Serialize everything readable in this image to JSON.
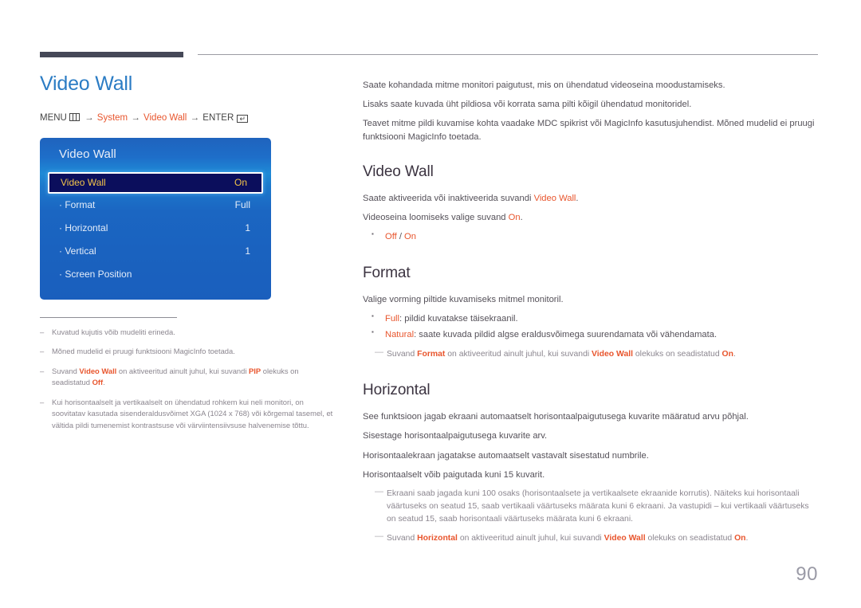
{
  "page": {
    "number": "90"
  },
  "left": {
    "title": "Video Wall",
    "menu_path": {
      "menu_label": "MENU",
      "menu_icon": "menu-grid-icon",
      "arrow": "→",
      "item1": "System",
      "item2": "Video Wall",
      "enter_label": "ENTER",
      "enter_icon": "enter-key-icon",
      "enter_glyph": "↵"
    },
    "osd": {
      "title": "Video Wall",
      "rows": [
        {
          "label": "Video Wall",
          "value": "On",
          "selected": true
        },
        {
          "label": "· Format",
          "value": "Full",
          "selected": false
        },
        {
          "label": "· Horizontal",
          "value": "1",
          "selected": false
        },
        {
          "label": "· Vertical",
          "value": "1",
          "selected": false
        },
        {
          "label": "· Screen Position",
          "value": "",
          "selected": false
        }
      ]
    },
    "notes": [
      {
        "dash": "–",
        "parts": [
          {
            "t": "Kuvatud kujutis võib mudeliti erineda.",
            "hot": false
          }
        ]
      },
      {
        "dash": "–",
        "parts": [
          {
            "t": "Mõned mudelid ei pruugi funktsiooni MagicInfo toetada.",
            "hot": false
          }
        ]
      },
      {
        "dash": "–",
        "parts": [
          {
            "t": "Suvand ",
            "hot": false
          },
          {
            "t": "Video Wall",
            "hot": true
          },
          {
            "t": " on aktiveeritud ainult juhul, kui suvandi ",
            "hot": false
          },
          {
            "t": "PIP",
            "hot": true
          },
          {
            "t": " olekuks on seadistatud ",
            "hot": false
          },
          {
            "t": "Off",
            "hot": true
          },
          {
            "t": ".",
            "hot": false
          }
        ]
      },
      {
        "dash": "–",
        "parts": [
          {
            "t": "Kui horisontaalselt ja vertikaalselt on ühendatud rohkem kui neli monitori, on soovitatav kasutada sisenderaldusvõimet XGA (1024 x 768) või kõrgemal tasemel, et vältida pildi tumenemist kontrastsuse või värviintensiivsuse halvenemise tõttu.",
            "hot": false
          }
        ]
      }
    ]
  },
  "right": {
    "intro": [
      "Saate kohandada mitme monitori paigutust, mis on ühendatud videoseina moodustamiseks.",
      "Lisaks saate kuvada üht pildiosa või korrata sama pilti kõigil ühendatud monitoridel.",
      "Teavet mitme pildi kuvamise kohta vaadake MDC spikrist või MagicInfo kasutusjuhendist. Mõned mudelid ei pruugi funktsiooni MagicInfo toetada."
    ],
    "sections": [
      {
        "heading": "Video Wall",
        "paras": [
          [
            {
              "t": "Saate aktiveerida või inaktiveerida suvandi ",
              "hot": false
            },
            {
              "t": "Video Wall",
              "hot": true
            },
            {
              "t": ".",
              "hot": false
            }
          ],
          [
            {
              "t": "Videoseina loomiseks valige suvand ",
              "hot": false
            },
            {
              "t": "On",
              "hot": true
            },
            {
              "t": ".",
              "hot": false
            }
          ]
        ],
        "bullets": [
          [
            {
              "t": "Off",
              "hot": true
            },
            {
              "t": " / ",
              "hot": false
            },
            {
              "t": "On",
              "hot": true
            }
          ]
        ],
        "notes": []
      },
      {
        "heading": "Format",
        "paras": [
          [
            {
              "t": "Valige vorming piltide kuvamiseks mitmel monitoril.",
              "hot": false
            }
          ]
        ],
        "bullets": [
          [
            {
              "t": "Full",
              "hot": true
            },
            {
              "t": ": pildid kuvatakse täisekraanil.",
              "hot": false
            }
          ],
          [
            {
              "t": "Natural",
              "hot": true
            },
            {
              "t": ": saate kuvada pildid algse eraldusvõimega suurendamata või vähendamata.",
              "hot": false
            }
          ]
        ],
        "notes": [
          {
            "dash": "—",
            "indent": true,
            "parts": [
              {
                "t": "Suvand ",
                "hot": false
              },
              {
                "t": "Format",
                "hot": true
              },
              {
                "t": " on aktiveeritud ainult juhul, kui suvandi ",
                "hot": false
              },
              {
                "t": "Video Wall",
                "hot": true
              },
              {
                "t": " olekuks on seadistatud ",
                "hot": false
              },
              {
                "t": "On",
                "hot": true
              },
              {
                "t": ".",
                "hot": false
              }
            ]
          }
        ]
      },
      {
        "heading": "Horizontal",
        "paras": [
          [
            {
              "t": "See funktsioon jagab ekraani automaatselt horisontaalpaigutusega kuvarite määratud arvu põhjal.",
              "hot": false
            }
          ],
          [
            {
              "t": "Sisestage horisontaalpaigutusega kuvarite arv.",
              "hot": false
            }
          ],
          [
            {
              "t": "Horisontaalekraan jagatakse automaatselt vastavalt sisestatud numbrile.",
              "hot": false
            }
          ],
          [
            {
              "t": "Horisontaalselt võib paigutada kuni 15 kuvarit.",
              "hot": false
            }
          ]
        ],
        "bullets": [],
        "notes": [
          {
            "dash": "—",
            "indent": true,
            "parts": [
              {
                "t": "Ekraani saab jagada kuni 100 osaks (horisontaalsete ja vertikaalsete ekraanide korrutis). Näiteks kui horisontaali väärtuseks on seatud 15, saab vertikaali väärtuseks määrata kuni 6 ekraani. Ja vastupidi – kui vertikaali väärtuseks on seatud 15, saab horisontaali väärtuseks määrata kuni 6 ekraani.",
                "hot": false
              }
            ]
          },
          {
            "dash": "—",
            "indent": true,
            "parts": [
              {
                "t": "Suvand ",
                "hot": false
              },
              {
                "t": "Horizontal",
                "hot": true
              },
              {
                "t": " on aktiveeritud ainult juhul, kui suvandi ",
                "hot": false
              },
              {
                "t": "Video Wall",
                "hot": true
              },
              {
                "t": " olekuks on seadistatud ",
                "hot": false
              },
              {
                "t": "On",
                "hot": true
              },
              {
                "t": ".",
                "hot": false
              }
            ]
          }
        ]
      }
    ]
  },
  "colors": {
    "accent_blue": "#2b7cc4",
    "accent_orange": "#e8552d",
    "heading_dark": "#3b3340",
    "rule_dark": "#454857",
    "osd_blue": "#1b66c2",
    "osd_selected_bg": "#0b0e5c",
    "osd_selected_text": "#f2c44a",
    "note_gray": "#8b868f",
    "page_num_gray": "#9a9aa6"
  }
}
